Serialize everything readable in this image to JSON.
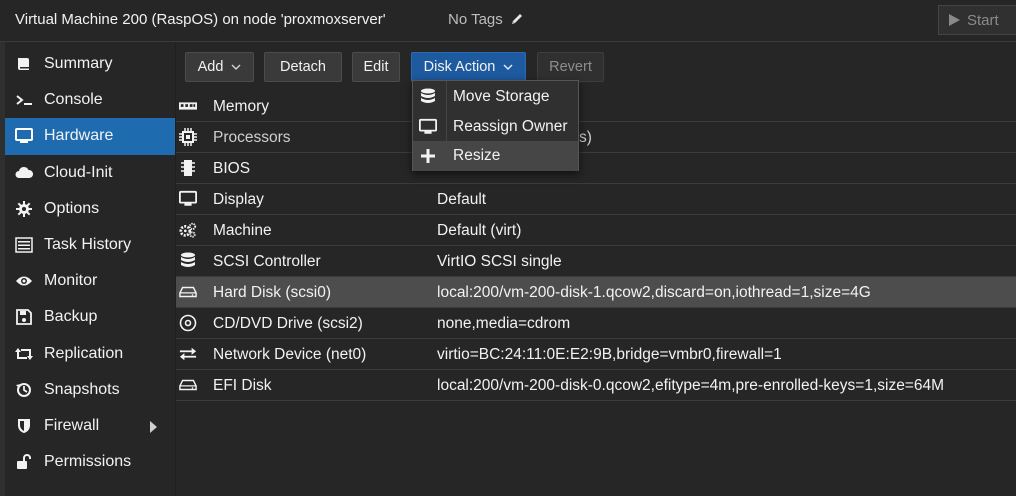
{
  "header": {
    "title": "Virtual Machine 200 (RaspOS) on node 'proxmoxserver'",
    "tags_label": "No Tags",
    "start_label": "Start"
  },
  "sidebar": {
    "items": [
      {
        "label": "Summary",
        "icon": "book-icon"
      },
      {
        "label": "Console",
        "icon": "terminal-icon"
      },
      {
        "label": "Hardware",
        "icon": "monitor-icon",
        "active": true
      },
      {
        "label": "Cloud-Init",
        "icon": "cloud-icon"
      },
      {
        "label": "Options",
        "icon": "gear-icon"
      },
      {
        "label": "Task History",
        "icon": "list-icon"
      },
      {
        "label": "Monitor",
        "icon": "eye-icon"
      },
      {
        "label": "Backup",
        "icon": "floppy-icon"
      },
      {
        "label": "Replication",
        "icon": "retweet-icon"
      },
      {
        "label": "Snapshots",
        "icon": "history-icon"
      },
      {
        "label": "Firewall",
        "icon": "shield-icon",
        "has_submenu": true
      },
      {
        "label": "Permissions",
        "icon": "unlock-icon"
      }
    ]
  },
  "toolbar": {
    "add_label": "Add",
    "detach_label": "Detach",
    "edit_label": "Edit",
    "disk_action_label": "Disk Action",
    "revert_label": "Revert"
  },
  "disk_action_menu": {
    "items": [
      {
        "label": "Move Storage",
        "icon": "database-icon"
      },
      {
        "label": "Reassign Owner",
        "icon": "desktop-icon"
      },
      {
        "label": "Resize",
        "icon": "plus-icon",
        "hover": true
      }
    ]
  },
  "hardware": {
    "rows": [
      {
        "name": "Memory",
        "value": "",
        "icon": "memory-icon"
      },
      {
        "name": "Processors",
        "value": "s)",
        "icon": "cpu-icon"
      },
      {
        "name": "BIOS",
        "value": "",
        "icon": "chip-icon"
      },
      {
        "name": "Display",
        "value": "Default",
        "icon": "monitor-icon"
      },
      {
        "name": "Machine",
        "value": "Default (virt)",
        "icon": "cogs-icon"
      },
      {
        "name": "SCSI Controller",
        "value": "VirtIO SCSI single",
        "icon": "database-icon"
      },
      {
        "name": "Hard Disk (scsi0)",
        "value": "local:200/vm-200-disk-1.qcow2,discard=on,iothread=1,size=4G",
        "icon": "hdd-icon",
        "selected": true
      },
      {
        "name": "CD/DVD Drive (scsi2)",
        "value": "none,media=cdrom",
        "icon": "cdrom-icon"
      },
      {
        "name": "Network Device (net0)",
        "value": "virtio=BC:24:11:0E:E2:9B,bridge=vmbr0,firewall=1",
        "icon": "exchange-icon"
      },
      {
        "name": "EFI Disk",
        "value": "local:200/vm-200-disk-0.qcow2,efitype=4m,pre-enrolled-keys=1,size=64M",
        "icon": "hdd-icon"
      }
    ]
  },
  "colors": {
    "background": "#262626",
    "accent": "#1e6bb0",
    "selected_row": "#4d4d4d"
  }
}
